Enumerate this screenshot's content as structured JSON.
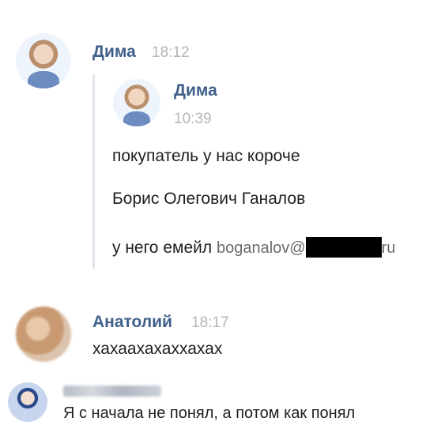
{
  "messages": [
    {
      "author": "Дима",
      "time": "18:12",
      "forwarded": {
        "author": "Дима",
        "time": "10:39",
        "lines": [
          "покупатель у нас короче",
          "Борис Олегович Ганалов",
          "у него емейл"
        ],
        "email_prefix": "boganalov@",
        "email_suffix": "ru"
      }
    },
    {
      "author": "Анатолий",
      "time": "18:17",
      "text": "хахаахахаххахах"
    },
    {
      "author": "",
      "time": "",
      "text": "Я с начала не понял, а потом как понял"
    }
  ]
}
